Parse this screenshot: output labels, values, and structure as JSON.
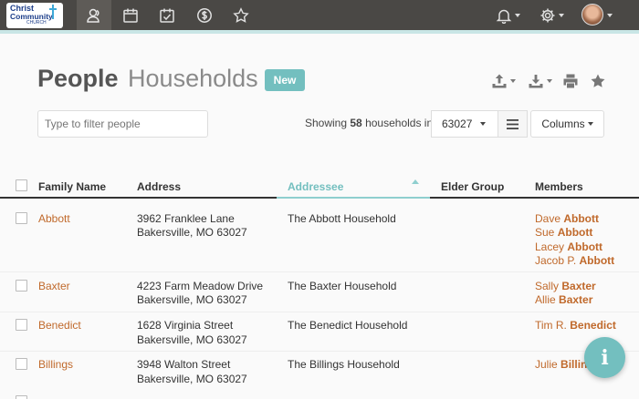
{
  "logo": {
    "line1": "Christ",
    "line2": "Community",
    "line3": "CHURCH"
  },
  "nav": [
    "people-icon",
    "calendar-icon",
    "checklist-icon",
    "giving-icon",
    "star-icon"
  ],
  "heading": {
    "title": "People",
    "subtitle": "Households",
    "new_label": "New"
  },
  "filter": {
    "placeholder": "Type to filter people"
  },
  "summary": {
    "prefix": "Showing",
    "count": "58",
    "suffix": "households in",
    "zip": "63027"
  },
  "columns_label": "Columns",
  "table": {
    "headers": [
      "Family Name",
      "Address",
      "Addressee",
      "Elder Group",
      "Members"
    ],
    "sorted_column": "Addressee",
    "rows": [
      {
        "family": "Abbott",
        "addr1": "3962 Franklee Lane",
        "addr2": "Bakersville, MO  63027",
        "addressee": "The Abbott Household",
        "elder": "",
        "members": [
          {
            "first": "Dave",
            "last": "Abbott"
          },
          {
            "first": "Sue",
            "last": "Abbott"
          },
          {
            "first": "Lacey",
            "last": "Abbott"
          },
          {
            "first": "Jacob P.",
            "last": "Abbott"
          }
        ]
      },
      {
        "family": "Baxter",
        "addr1": "4223 Farm Meadow Drive",
        "addr2": "Bakersville, MO  63027",
        "addressee": "The Baxter Household",
        "elder": "",
        "members": [
          {
            "first": "Sally",
            "last": "Baxter"
          },
          {
            "first": "Allie",
            "last": "Baxter"
          }
        ]
      },
      {
        "family": "Benedict",
        "addr1": "1628 Virginia Street",
        "addr2": "Bakersville, MO  63027",
        "addressee": "The Benedict Household",
        "elder": "",
        "members": [
          {
            "first": "Tim R.",
            "last": "Benedict"
          }
        ]
      },
      {
        "family": "Billings",
        "addr1": "3948 Walton Street",
        "addr2": "Bakersville, MO  63027",
        "addressee": "The Billings Household",
        "elder": "",
        "members": [
          {
            "first": "Julie",
            "last": "Billings"
          }
        ]
      }
    ]
  },
  "colors": {
    "topbar": "#4a4845",
    "accent": "#73bfbf",
    "link": "#c0692b"
  }
}
